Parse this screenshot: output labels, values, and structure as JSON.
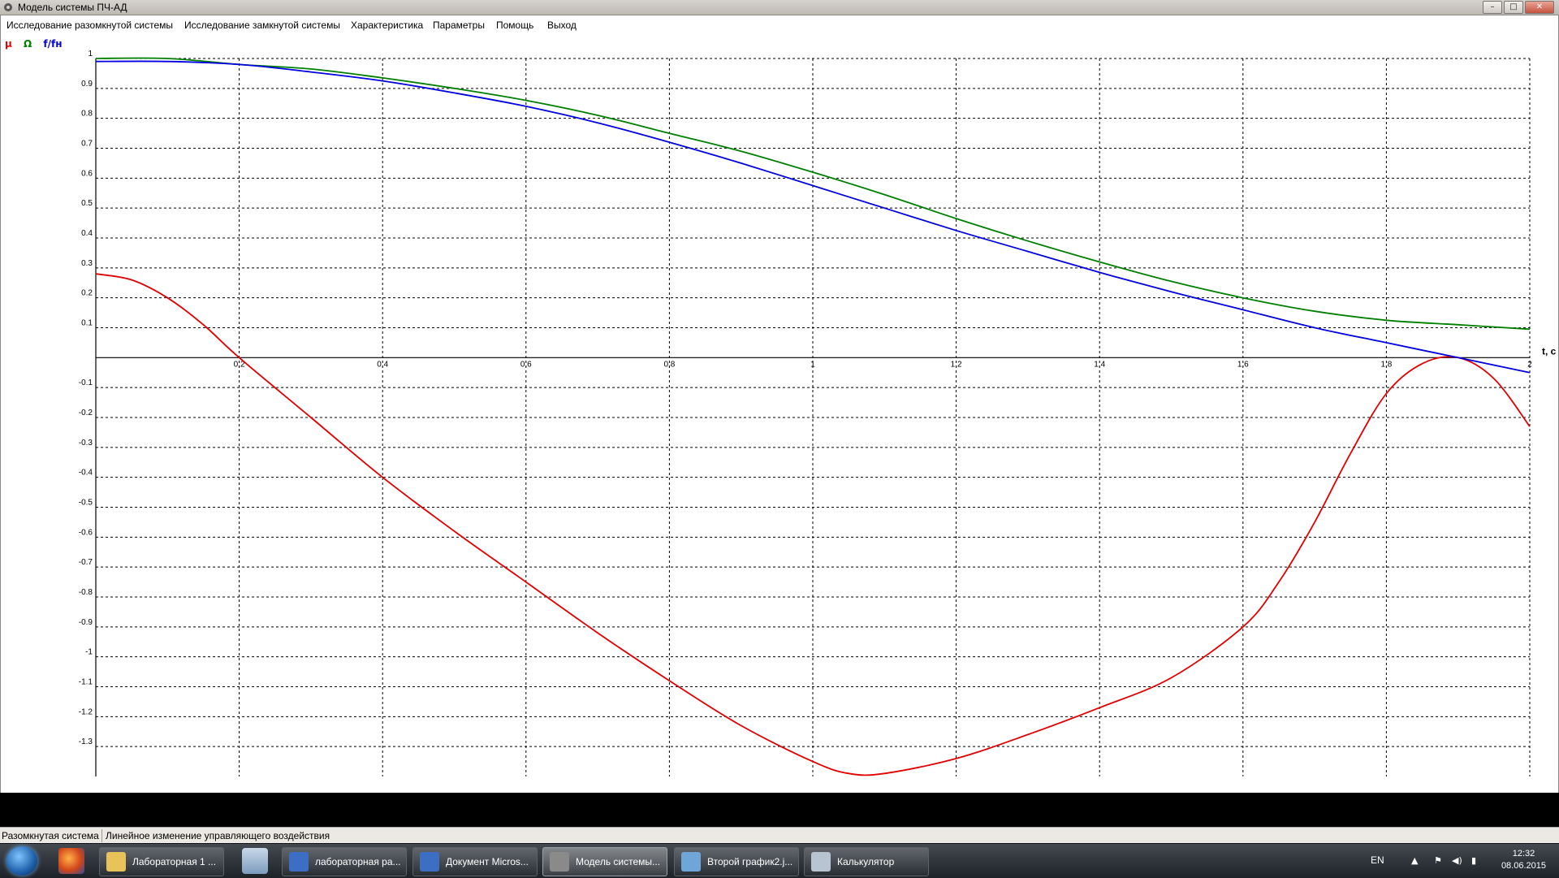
{
  "window": {
    "title": "Модель системы ПЧ-АД",
    "minimize_glyph": "–",
    "maximize_glyph": "□",
    "close_glyph": "✕"
  },
  "menu": [
    "Исследование разомкнутой системы",
    "Исследование замкнутой системы",
    "Характеристика",
    "Параметры",
    "Помощь",
    "Выход"
  ],
  "legend": [
    {
      "label": "μ",
      "color": "#e00000"
    },
    {
      "label": "Ω",
      "color": "#008000"
    },
    {
      "label": "f/fн",
      "color": "#0000e0"
    }
  ],
  "chart_data": {
    "type": "line",
    "xlabel": "t, c",
    "ylabel": "",
    "xlim": [
      0,
      2
    ],
    "ylim": [
      -1.4,
      1
    ],
    "xticks": [
      0.2,
      0.4,
      0.6,
      0.8,
      1,
      1.2,
      1.4,
      1.6,
      1.8,
      2
    ],
    "yticks": [
      1,
      0.9,
      0.8,
      0.7,
      0.6,
      0.5,
      0.4,
      0.3,
      0.2,
      0.1,
      -0.1,
      -0.2,
      -0.3,
      -0.4,
      -0.5,
      -0.6,
      -0.7,
      -0.8,
      -0.9,
      -1,
      -1.1,
      -1.2,
      -1.3
    ],
    "grid": true,
    "series": [
      {
        "name": "μ",
        "color": "#e00000",
        "x": [
          0,
          0.05,
          0.1,
          0.15,
          0.2,
          0.3,
          0.4,
          0.5,
          0.6,
          0.7,
          0.8,
          0.9,
          1.0,
          1.05,
          1.1,
          1.2,
          1.3,
          1.4,
          1.5,
          1.6,
          1.65,
          1.7,
          1.75,
          1.8,
          1.85,
          1.9,
          1.95,
          2.0
        ],
        "y": [
          0.28,
          0.26,
          0.2,
          0.11,
          0.0,
          -0.2,
          -0.4,
          -0.58,
          -0.75,
          -0.92,
          -1.08,
          -1.23,
          -1.35,
          -1.39,
          -1.39,
          -1.34,
          -1.26,
          -1.17,
          -1.07,
          -0.9,
          -0.75,
          -0.55,
          -0.32,
          -0.12,
          -0.02,
          0.0,
          -0.07,
          -0.23
        ]
      },
      {
        "name": "Ω",
        "color": "#008000",
        "x": [
          0,
          0.1,
          0.2,
          0.3,
          0.4,
          0.5,
          0.6,
          0.7,
          0.8,
          0.9,
          1.0,
          1.1,
          1.2,
          1.3,
          1.4,
          1.5,
          1.6,
          1.7,
          1.8,
          1.9,
          2.0
        ],
        "y": [
          1.0,
          1.0,
          0.98,
          0.965,
          0.935,
          0.9,
          0.86,
          0.81,
          0.75,
          0.69,
          0.62,
          0.545,
          0.465,
          0.39,
          0.32,
          0.255,
          0.2,
          0.155,
          0.125,
          0.11,
          0.095
        ]
      },
      {
        "name": "f/fн",
        "color": "#0000e0",
        "x": [
          0,
          0.1,
          0.2,
          0.3,
          0.4,
          0.5,
          0.6,
          0.7,
          0.8,
          0.9,
          1.0,
          1.1,
          1.2,
          1.3,
          1.4,
          1.5,
          1.6,
          1.7,
          1.8,
          1.9,
          2.0
        ],
        "y": [
          0.99,
          0.99,
          0.98,
          0.955,
          0.925,
          0.885,
          0.84,
          0.785,
          0.72,
          0.65,
          0.575,
          0.5,
          0.425,
          0.355,
          0.285,
          0.22,
          0.16,
          0.1,
          0.05,
          0.0,
          -0.05
        ]
      }
    ]
  },
  "statusbar": {
    "mode": "Разомкнутая система",
    "description": "Линейное изменение управляющего воздействия"
  },
  "taskbar": {
    "tasks": [
      {
        "label": "Лабораторная 1 ...",
        "icon": "folder-icon",
        "color": "#e8c35a"
      },
      {
        "label": "лабораторная ра...",
        "icon": "word-doc-icon",
        "color": "#3c6fc4"
      },
      {
        "label": "Документ Micros...",
        "icon": "word-doc-icon",
        "color": "#3c6fc4"
      },
      {
        "label": "Модель системы...",
        "icon": "gear-icon",
        "color": "#8a8a8a"
      },
      {
        "label": "Второй график2.j...",
        "icon": "image-viewer-icon",
        "color": "#6fa6d8"
      },
      {
        "label": "Калькулятор",
        "icon": "calculator-icon",
        "color": "#b9c4d2"
      }
    ],
    "lang": "EN",
    "time": "12:32",
    "date": "08.06.2015"
  }
}
